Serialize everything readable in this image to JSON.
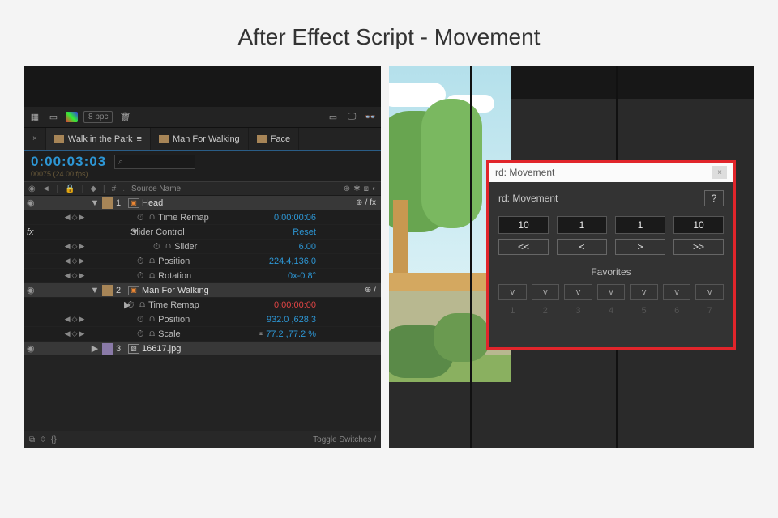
{
  "page_title": "After Effect Script - Movement",
  "toolbar": {
    "bpc_label": "8 bpc"
  },
  "tabs": [
    {
      "label": "Walk in the Park",
      "active": true,
      "close": "×",
      "menu": "≡"
    },
    {
      "label": "Man For Walking",
      "active": false
    },
    {
      "label": "Face",
      "active": false
    }
  ],
  "timecode": "0:00:03:03",
  "frame_sub": "00075 (24.00 fps)",
  "search_placeholder": "⌕",
  "col_headers": {
    "hash": "#",
    "src": "Source Name"
  },
  "layers": [
    {
      "idx": "1",
      "name": "Head",
      "switches": [
        "⊕",
        "/",
        "fx"
      ],
      "color": "tan",
      "props": [
        {
          "name": "Time Remap",
          "val": "0:00:00:06",
          "kf": true,
          "stopwatch": true
        },
        {
          "name": "Slider Control",
          "val": "Reset",
          "group": true
        },
        {
          "name": "Slider",
          "val": "6.00",
          "indent": 3,
          "kf": true,
          "stopwatch": true
        },
        {
          "name": "Position",
          "val": "224.4,136.0",
          "indent": 2,
          "kf": true,
          "stopwatch": true
        },
        {
          "name": "Rotation",
          "val": "0x-0.8°",
          "indent": 2,
          "kf": true,
          "stopwatch": true
        }
      ]
    },
    {
      "idx": "2",
      "name": "Man For Walking",
      "switches": [
        "⊕",
        "/"
      ],
      "color": "tan",
      "props": [
        {
          "name": "Time Remap",
          "val": "0:00:00:00",
          "val_color": "red",
          "kf": false,
          "stopwatch": true,
          "closed": true
        },
        {
          "name": "Position",
          "val": "932.0 ,628.3",
          "indent": 2,
          "kf": true,
          "stopwatch": true
        },
        {
          "name": "Scale",
          "val": "77.2 ,77.2 %",
          "indent": 2,
          "link": true,
          "stopwatch": true
        }
      ]
    },
    {
      "idx": "3",
      "name": "16617.jpg",
      "switches": [],
      "color": "purple",
      "closed": true
    }
  ],
  "fx_label": "fx",
  "footer": {
    "toggle": "Toggle Switches / "
  },
  "movement": {
    "window_title": "rd: Movement",
    "panel_label": "rd: Movement",
    "help": "?",
    "steps": [
      "10",
      "1",
      "1",
      "10"
    ],
    "nav": [
      "<<",
      "<",
      ">",
      ">>"
    ],
    "favorites_label": "Favorites",
    "fav_btns": [
      "v",
      "v",
      "v",
      "v",
      "v",
      "v",
      "v"
    ],
    "fav_nums": [
      "1",
      "2",
      "3",
      "4",
      "5",
      "6",
      "7"
    ]
  }
}
